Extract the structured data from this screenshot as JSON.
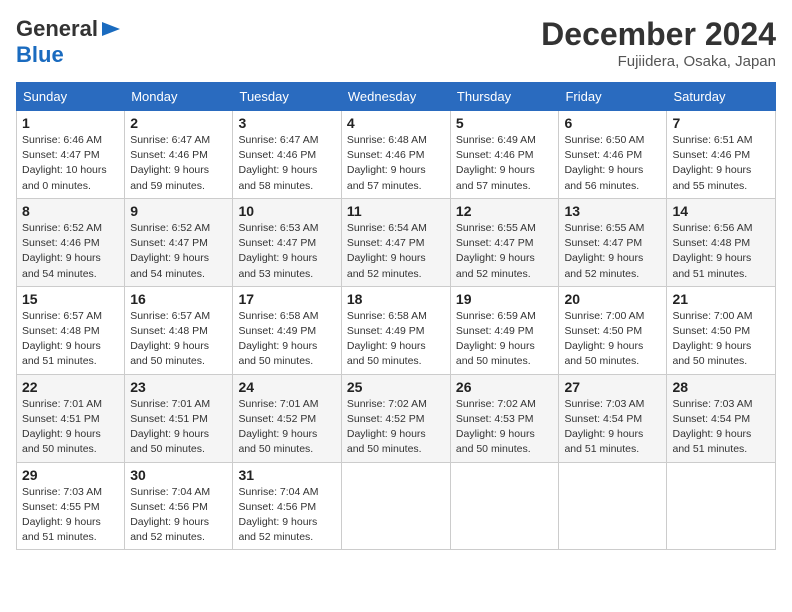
{
  "header": {
    "logo_line1": "General",
    "logo_line2": "Blue",
    "month_year": "December 2024",
    "location": "Fujiidera, Osaka, Japan"
  },
  "columns": [
    "Sunday",
    "Monday",
    "Tuesday",
    "Wednesday",
    "Thursday",
    "Friday",
    "Saturday"
  ],
  "weeks": [
    [
      {
        "day": "1",
        "sunrise": "Sunrise: 6:46 AM",
        "sunset": "Sunset: 4:47 PM",
        "daylight": "Daylight: 10 hours and 0 minutes."
      },
      {
        "day": "2",
        "sunrise": "Sunrise: 6:47 AM",
        "sunset": "Sunset: 4:46 PM",
        "daylight": "Daylight: 9 hours and 59 minutes."
      },
      {
        "day": "3",
        "sunrise": "Sunrise: 6:47 AM",
        "sunset": "Sunset: 4:46 PM",
        "daylight": "Daylight: 9 hours and 58 minutes."
      },
      {
        "day": "4",
        "sunrise": "Sunrise: 6:48 AM",
        "sunset": "Sunset: 4:46 PM",
        "daylight": "Daylight: 9 hours and 57 minutes."
      },
      {
        "day": "5",
        "sunrise": "Sunrise: 6:49 AM",
        "sunset": "Sunset: 4:46 PM",
        "daylight": "Daylight: 9 hours and 57 minutes."
      },
      {
        "day": "6",
        "sunrise": "Sunrise: 6:50 AM",
        "sunset": "Sunset: 4:46 PM",
        "daylight": "Daylight: 9 hours and 56 minutes."
      },
      {
        "day": "7",
        "sunrise": "Sunrise: 6:51 AM",
        "sunset": "Sunset: 4:46 PM",
        "daylight": "Daylight: 9 hours and 55 minutes."
      }
    ],
    [
      {
        "day": "8",
        "sunrise": "Sunrise: 6:52 AM",
        "sunset": "Sunset: 4:46 PM",
        "daylight": "Daylight: 9 hours and 54 minutes."
      },
      {
        "day": "9",
        "sunrise": "Sunrise: 6:52 AM",
        "sunset": "Sunset: 4:47 PM",
        "daylight": "Daylight: 9 hours and 54 minutes."
      },
      {
        "day": "10",
        "sunrise": "Sunrise: 6:53 AM",
        "sunset": "Sunset: 4:47 PM",
        "daylight": "Daylight: 9 hours and 53 minutes."
      },
      {
        "day": "11",
        "sunrise": "Sunrise: 6:54 AM",
        "sunset": "Sunset: 4:47 PM",
        "daylight": "Daylight: 9 hours and 52 minutes."
      },
      {
        "day": "12",
        "sunrise": "Sunrise: 6:55 AM",
        "sunset": "Sunset: 4:47 PM",
        "daylight": "Daylight: 9 hours and 52 minutes."
      },
      {
        "day": "13",
        "sunrise": "Sunrise: 6:55 AM",
        "sunset": "Sunset: 4:47 PM",
        "daylight": "Daylight: 9 hours and 52 minutes."
      },
      {
        "day": "14",
        "sunrise": "Sunrise: 6:56 AM",
        "sunset": "Sunset: 4:48 PM",
        "daylight": "Daylight: 9 hours and 51 minutes."
      }
    ],
    [
      {
        "day": "15",
        "sunrise": "Sunrise: 6:57 AM",
        "sunset": "Sunset: 4:48 PM",
        "daylight": "Daylight: 9 hours and 51 minutes."
      },
      {
        "day": "16",
        "sunrise": "Sunrise: 6:57 AM",
        "sunset": "Sunset: 4:48 PM",
        "daylight": "Daylight: 9 hours and 50 minutes."
      },
      {
        "day": "17",
        "sunrise": "Sunrise: 6:58 AM",
        "sunset": "Sunset: 4:49 PM",
        "daylight": "Daylight: 9 hours and 50 minutes."
      },
      {
        "day": "18",
        "sunrise": "Sunrise: 6:58 AM",
        "sunset": "Sunset: 4:49 PM",
        "daylight": "Daylight: 9 hours and 50 minutes."
      },
      {
        "day": "19",
        "sunrise": "Sunrise: 6:59 AM",
        "sunset": "Sunset: 4:49 PM",
        "daylight": "Daylight: 9 hours and 50 minutes."
      },
      {
        "day": "20",
        "sunrise": "Sunrise: 7:00 AM",
        "sunset": "Sunset: 4:50 PM",
        "daylight": "Daylight: 9 hours and 50 minutes."
      },
      {
        "day": "21",
        "sunrise": "Sunrise: 7:00 AM",
        "sunset": "Sunset: 4:50 PM",
        "daylight": "Daylight: 9 hours and 50 minutes."
      }
    ],
    [
      {
        "day": "22",
        "sunrise": "Sunrise: 7:01 AM",
        "sunset": "Sunset: 4:51 PM",
        "daylight": "Daylight: 9 hours and 50 minutes."
      },
      {
        "day": "23",
        "sunrise": "Sunrise: 7:01 AM",
        "sunset": "Sunset: 4:51 PM",
        "daylight": "Daylight: 9 hours and 50 minutes."
      },
      {
        "day": "24",
        "sunrise": "Sunrise: 7:01 AM",
        "sunset": "Sunset: 4:52 PM",
        "daylight": "Daylight: 9 hours and 50 minutes."
      },
      {
        "day": "25",
        "sunrise": "Sunrise: 7:02 AM",
        "sunset": "Sunset: 4:52 PM",
        "daylight": "Daylight: 9 hours and 50 minutes."
      },
      {
        "day": "26",
        "sunrise": "Sunrise: 7:02 AM",
        "sunset": "Sunset: 4:53 PM",
        "daylight": "Daylight: 9 hours and 50 minutes."
      },
      {
        "day": "27",
        "sunrise": "Sunrise: 7:03 AM",
        "sunset": "Sunset: 4:54 PM",
        "daylight": "Daylight: 9 hours and 51 minutes."
      },
      {
        "day": "28",
        "sunrise": "Sunrise: 7:03 AM",
        "sunset": "Sunset: 4:54 PM",
        "daylight": "Daylight: 9 hours and 51 minutes."
      }
    ],
    [
      {
        "day": "29",
        "sunrise": "Sunrise: 7:03 AM",
        "sunset": "Sunset: 4:55 PM",
        "daylight": "Daylight: 9 hours and 51 minutes."
      },
      {
        "day": "30",
        "sunrise": "Sunrise: 7:04 AM",
        "sunset": "Sunset: 4:56 PM",
        "daylight": "Daylight: 9 hours and 52 minutes."
      },
      {
        "day": "31",
        "sunrise": "Sunrise: 7:04 AM",
        "sunset": "Sunset: 4:56 PM",
        "daylight": "Daylight: 9 hours and 52 minutes."
      },
      null,
      null,
      null,
      null
    ]
  ]
}
